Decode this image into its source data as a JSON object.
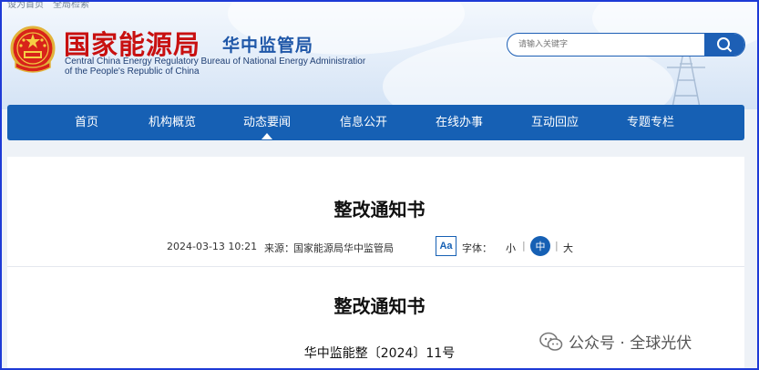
{
  "topbar": {
    "links": [
      "设为首页",
      "全局检索"
    ]
  },
  "site": {
    "title": "国家能源局",
    "subtitle": "华中监管局",
    "en_line1": "Central China Energy Regulatory Bureau of National Energy Administratior",
    "en_line2": "of the People's Republic of China"
  },
  "search": {
    "placeholder": "请输入关键字"
  },
  "nav": {
    "items": [
      "首页",
      "机构概览",
      "动态要闻",
      "信息公开",
      "在线办事",
      "互动回应",
      "专题专栏"
    ],
    "active_index": 2
  },
  "article": {
    "title": "整改通知书",
    "date": "2024-03-13 10:21",
    "source_label": "来源：",
    "source": "国家能源局华中监管局",
    "font_icon": "Aa",
    "font_label": "字体：",
    "sizes": [
      "小",
      "中",
      "大"
    ],
    "size_active": "中",
    "body_title": "整改通知书",
    "doc_number": "华中监能整〔2024〕11号"
  },
  "watermark": {
    "text": "公众号 · 全球光伏"
  },
  "colors": {
    "brand_red": "#c81010",
    "nav_blue": "#1660b4",
    "sub_blue": "#1f57a8"
  }
}
